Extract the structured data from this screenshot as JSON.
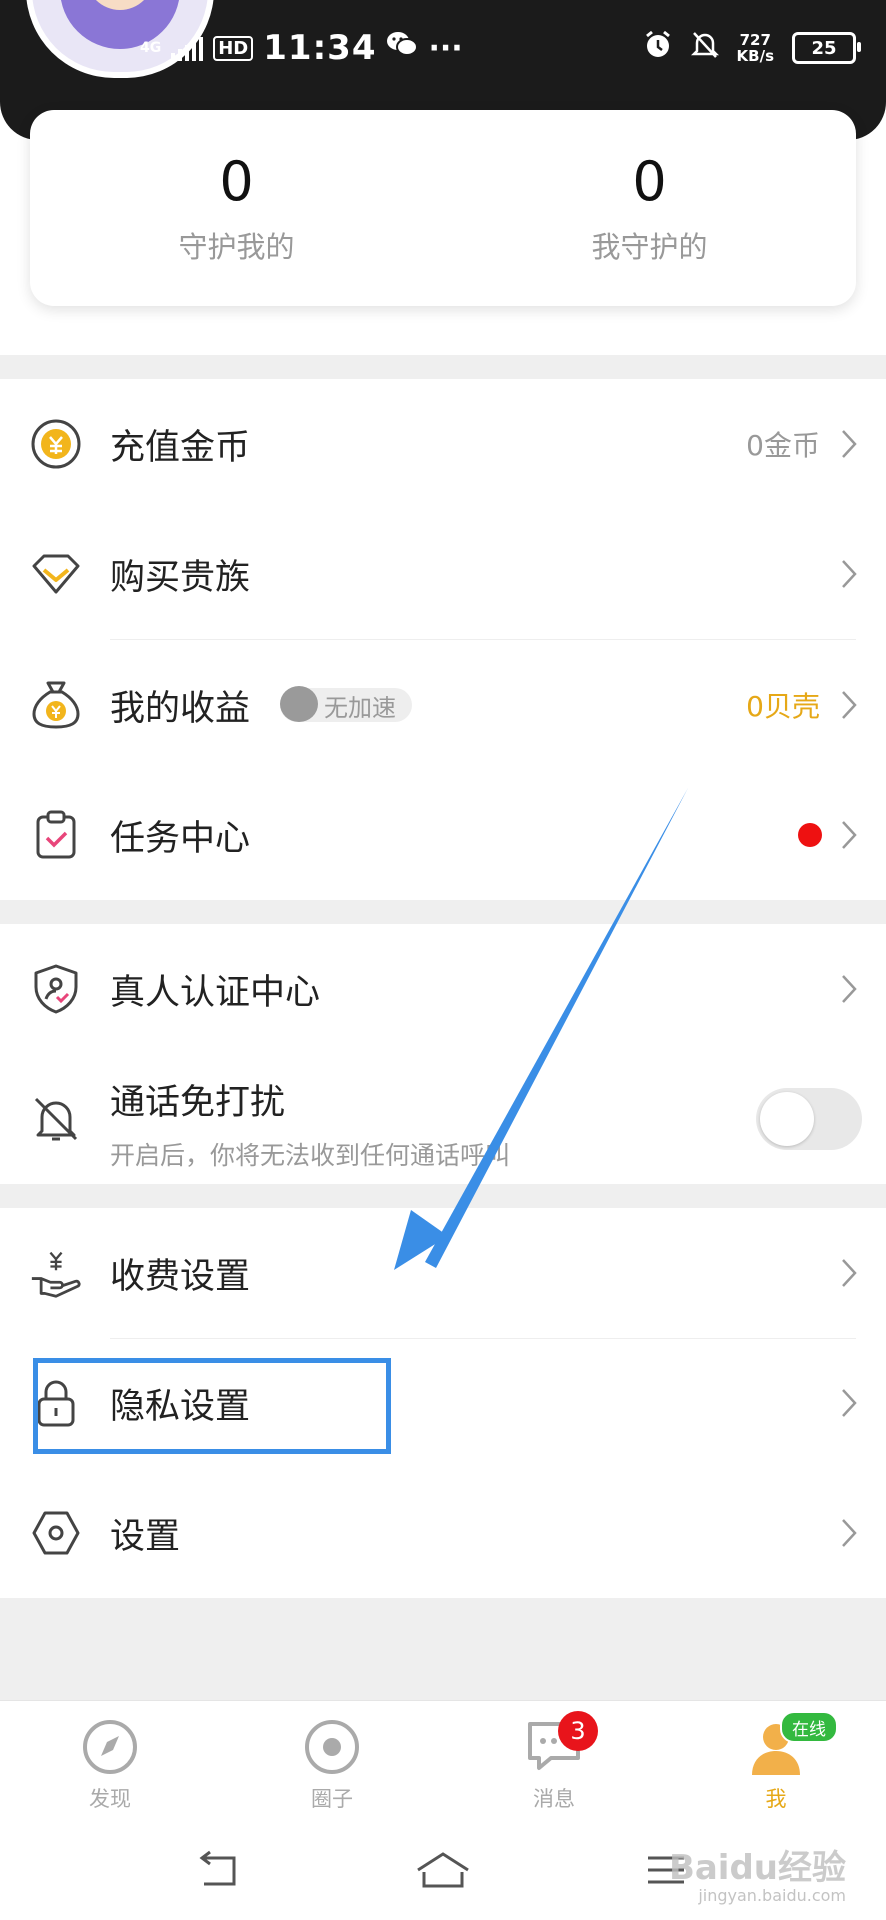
{
  "status_bar": {
    "network": "4G",
    "hd": "HD",
    "time": "11:34",
    "more": "···",
    "net_speed_value": "727",
    "net_speed_unit": "KB/s",
    "battery": "25"
  },
  "stats": [
    {
      "value": "0",
      "label": "守护我的"
    },
    {
      "value": "0",
      "label": "我守护的"
    }
  ],
  "menu": {
    "recharge": {
      "label": "充值金币",
      "value": "0金币",
      "icon": "coin-icon"
    },
    "vip": {
      "label": "购买贵族",
      "icon": "diamond-icon"
    },
    "earnings": {
      "label": "我的收益",
      "tag": "无加速",
      "value": "0贝壳",
      "icon": "money-bag-icon"
    },
    "tasks": {
      "label": "任务中心",
      "icon": "clipboard-icon"
    },
    "verify": {
      "label": "真人认证中心",
      "icon": "shield-user-icon"
    },
    "dnd": {
      "label": "通话免打扰",
      "sub": "开启后，你将无法收到任何通话呼叫",
      "enabled": false,
      "icon": "bell-off-icon"
    },
    "fee": {
      "label": "收费设置",
      "icon": "hand-coin-icon"
    },
    "privacy": {
      "label": "隐私设置",
      "icon": "lock-icon"
    },
    "settings": {
      "label": "设置",
      "icon": "hexagon-gear-icon"
    }
  },
  "tabs": [
    {
      "label": "发现",
      "icon": "compass-icon"
    },
    {
      "label": "圈子",
      "icon": "circle-dot-icon"
    },
    {
      "label": "消息",
      "icon": "chat-bubble-icon",
      "badge": "3"
    },
    {
      "label": "我",
      "icon": "user-avatar-icon",
      "status": "在线",
      "active": true
    }
  ],
  "colors": {
    "accent_gold": "#e6a817",
    "highlight_blue": "#3a8ee6",
    "badge_red": "#e8141b",
    "online_green": "#33b93f"
  },
  "watermark": {
    "brand": "Baidu经验",
    "url": "jingyan.baidu.com"
  }
}
